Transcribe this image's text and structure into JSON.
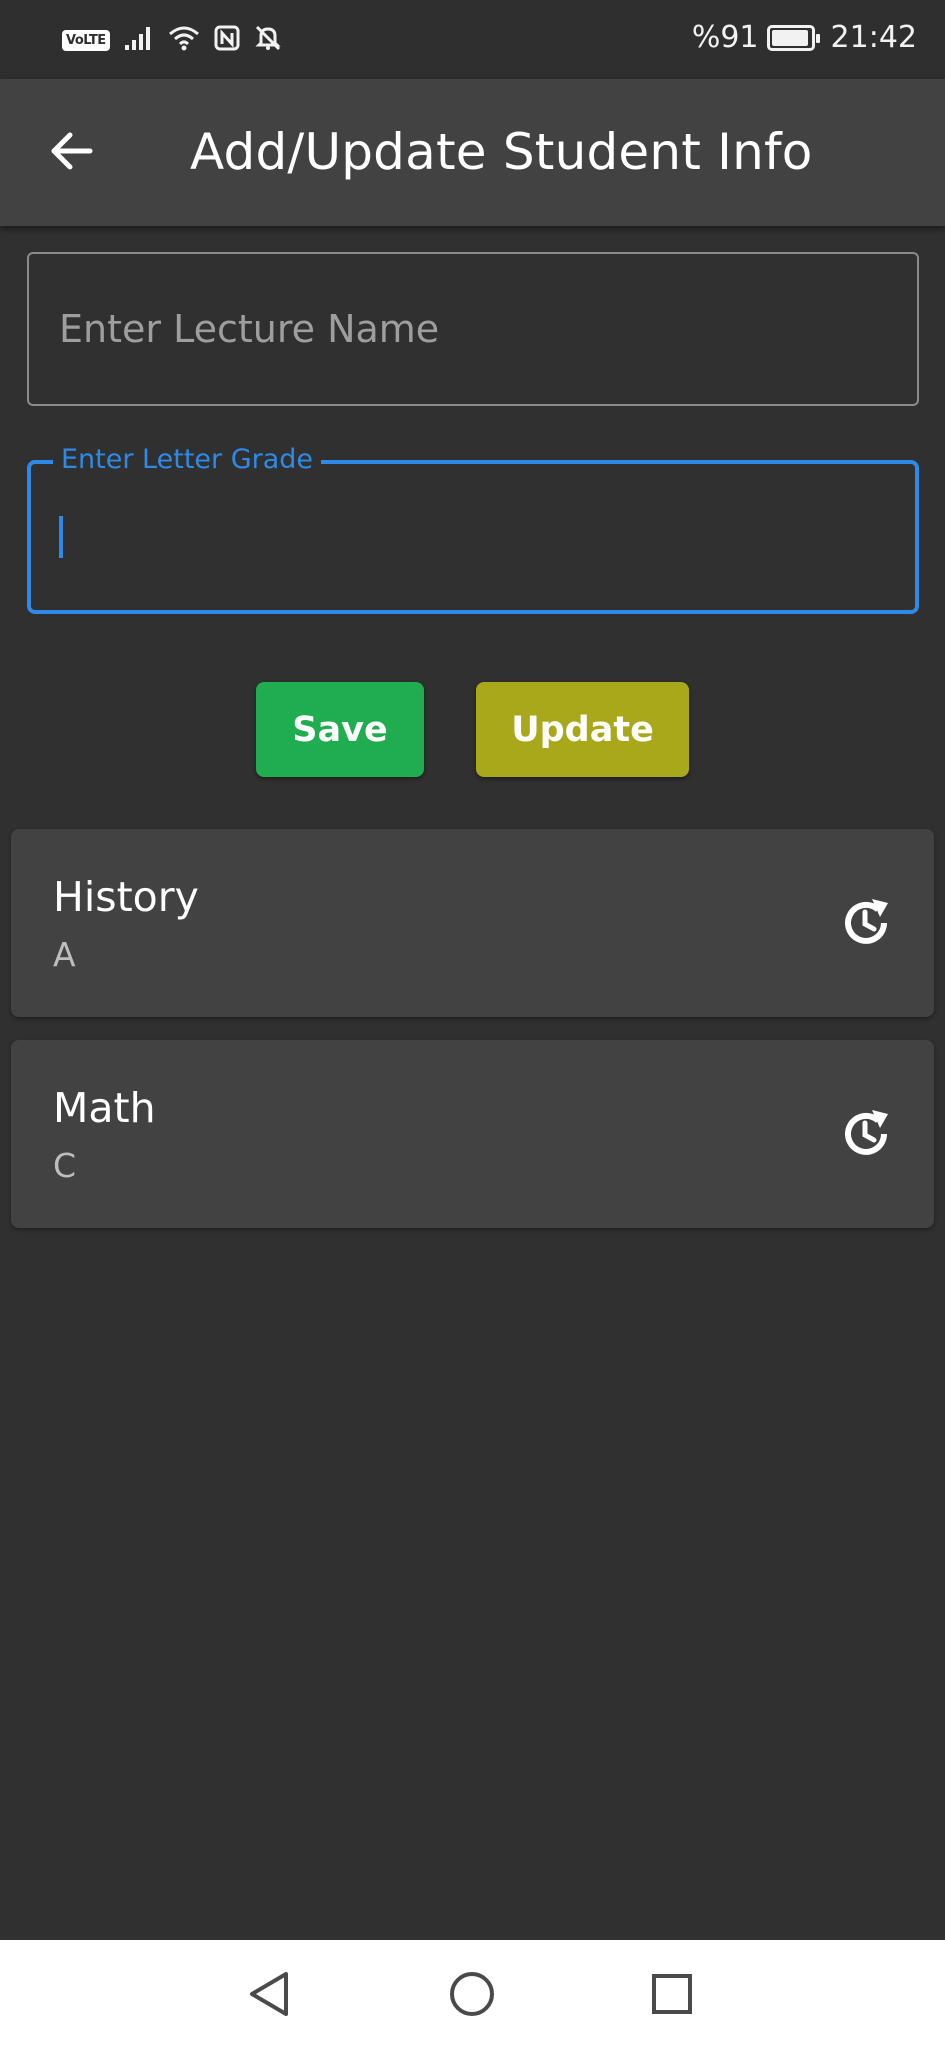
{
  "status_bar": {
    "volte_label": "VoLTE",
    "battery_text": "%91",
    "time": "21:42",
    "icons": [
      "signal-icon",
      "wifi-icon",
      "nfc-icon",
      "bell-off-icon",
      "battery-charging-icon"
    ]
  },
  "app_bar": {
    "title": "Add/Update Student Info",
    "back_icon": "arrow-left-icon"
  },
  "form": {
    "lecture_field": {
      "placeholder": "Enter Lecture Name",
      "value": ""
    },
    "grade_field": {
      "label": "Enter Letter Grade",
      "value": "",
      "focused": true
    }
  },
  "actions": {
    "save_label": "Save",
    "update_label": "Update"
  },
  "records": [
    {
      "lecture": "History",
      "grade": "A",
      "action_icon": "history-icon"
    },
    {
      "lecture": "Math",
      "grade": "C",
      "action_icon": "history-icon"
    }
  ],
  "nav": {
    "icons": [
      "back-triangle-icon",
      "home-circle-icon",
      "recents-square-icon"
    ]
  },
  "colors": {
    "background": "#303030",
    "app_bar": "#424242",
    "accent_focus": "#2e8ae6",
    "save": "#1fad4f",
    "update": "#a9a81a",
    "card": "#424242"
  }
}
